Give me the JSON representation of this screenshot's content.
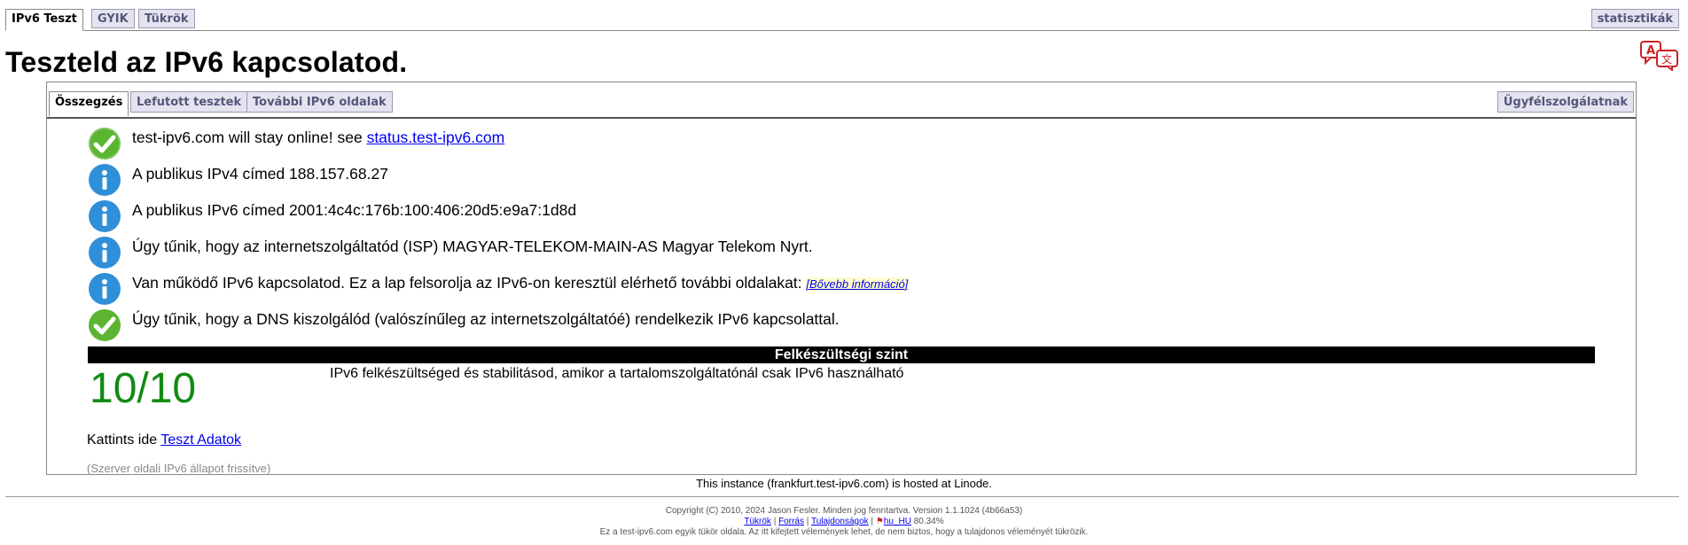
{
  "top_tabs": {
    "ipv6_test": "IPv6 Teszt",
    "faq": "GYIK",
    "mirrors": "Tükrök",
    "stats": "statisztikák"
  },
  "page_title": "Teszteld az IPv6 kapcsolatod.",
  "sub_tabs": {
    "summary": "Összegzés",
    "tests_run": "Lefutott tesztek",
    "other_sites": "További IPv6 oldalak",
    "helpdesk": "Ügyfélszolgálatnak"
  },
  "results": [
    {
      "icon": "check-icon",
      "text": "test-ipv6.com will stay online! see ",
      "link": "status.test-ipv6.com"
    },
    {
      "icon": "info-icon",
      "text": "A publikus IPv4 címed 188.157.68.27"
    },
    {
      "icon": "info-icon",
      "text": "A publikus IPv6 címed 2001:4c4c:176b:100:406:20d5:e9a7:1d8d"
    },
    {
      "icon": "info-icon",
      "text": "Úgy tűnik, hogy az internetszolgáltatód (ISP) MAGYAR-TELEKOM-MAIN-AS Magyar Telekom Nyrt."
    },
    {
      "icon": "info-icon",
      "text": "Van működő IPv6 kapcsolatod. Ez a lap felsorolja az IPv6-on keresztül elérhető további oldalakat: ",
      "more": "[Bővebb információ]"
    },
    {
      "icon": "check-icon",
      "text": "Úgy tűnik, hogy a DNS kiszolgálód (valószínűleg az internetszolgáltatóé) rendelkezik IPv6 kapcsolattal."
    }
  ],
  "readiness": {
    "header": "Felkészültségi szint",
    "score": "10/10",
    "description": "IPv6 felkészültséged és stabilitásod, amikor a tartalomszolgáltatónál csak IPv6 használható"
  },
  "test_data": {
    "prefix": "Kattints ide ",
    "link": "Teszt Adatok"
  },
  "server_note": "(Szerver oldali IPv6 állapot frissítve)",
  "hosted": "This instance (frankfurt.test-ipv6.com) is hosted at Linode.",
  "footer": {
    "copyright": "Copyright (C) 2010, 2024 Jason Fesler. Minden jog fenntartva. Version 1.1.1024 (4b66a53)",
    "mirrors": "Tükrök",
    "source": "Forrás",
    "ownership": "Tulajdonságok",
    "locale": "hu_HU",
    "locale_pct": "80.34%",
    "disclaimer": "Ez a test-ipv6.com egyik tükör oldala. Az itt kifejtett vélemények lehet, de nem biztos, hogy a tulajdonos véleményét tükrözik."
  },
  "colors": {
    "check": "#5cb531",
    "info": "#2f8fd8",
    "score": "#138a13"
  }
}
